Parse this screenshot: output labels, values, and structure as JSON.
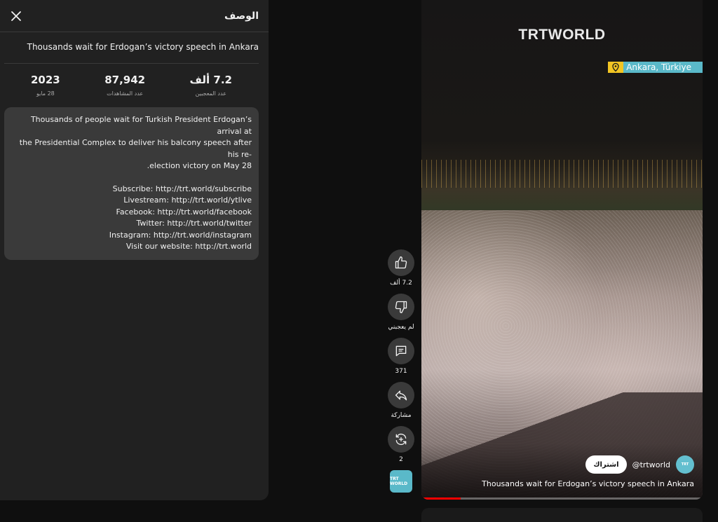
{
  "panel": {
    "title": "الوصف",
    "close_icon": "close-icon",
    "video_title": "Thousands wait for Erdogan’s victory speech in Ankara",
    "stats": [
      {
        "value": "7.2 ألف",
        "label": "عدد المعجبين"
      },
      {
        "value": "87,942",
        "label": "عدد المشاهدات"
      },
      {
        "value": "2023",
        "label": "28 مايو"
      }
    ],
    "description": [
      "Thousands of people wait for Turkish President Erdogan’s arrival at",
      "the Presidential Complex to deliver his balcony speech after his re-",
      ".election victory on May 28"
    ],
    "links": [
      "Subscribe: http://trt.world/subscribe",
      "Livestream: http://trt.world/ytlive",
      "Facebook: http://trt.world/facebook",
      "Twitter: http://trt.world/twitter",
      "Instagram: http://trt.world/instagram",
      "Visit our website: http://trt.world"
    ]
  },
  "video": {
    "watermark": "TRTWORLD",
    "location": "Ankara, Türkiye",
    "subscribe_label": "اشتراك",
    "channel_handle": "@trtworld",
    "caption": "Thousands wait for Erdogan’s victory speech in Ankara",
    "progress": 0.14,
    "colors": {
      "progress": "#ff0000",
      "location_bg": "#5ab9c9",
      "pin_bg": "#f2c523"
    }
  },
  "actions": [
    {
      "icon": "thumb-up-icon",
      "label": "7.2 ألف"
    },
    {
      "icon": "thumb-down-icon",
      "label": "لم يعجبني"
    },
    {
      "icon": "comment-icon",
      "label": "371"
    },
    {
      "icon": "share-icon",
      "label": "مشاركة"
    },
    {
      "icon": "remix-icon",
      "label": "2"
    }
  ],
  "channel_thumb_text": "TRT WORLD"
}
